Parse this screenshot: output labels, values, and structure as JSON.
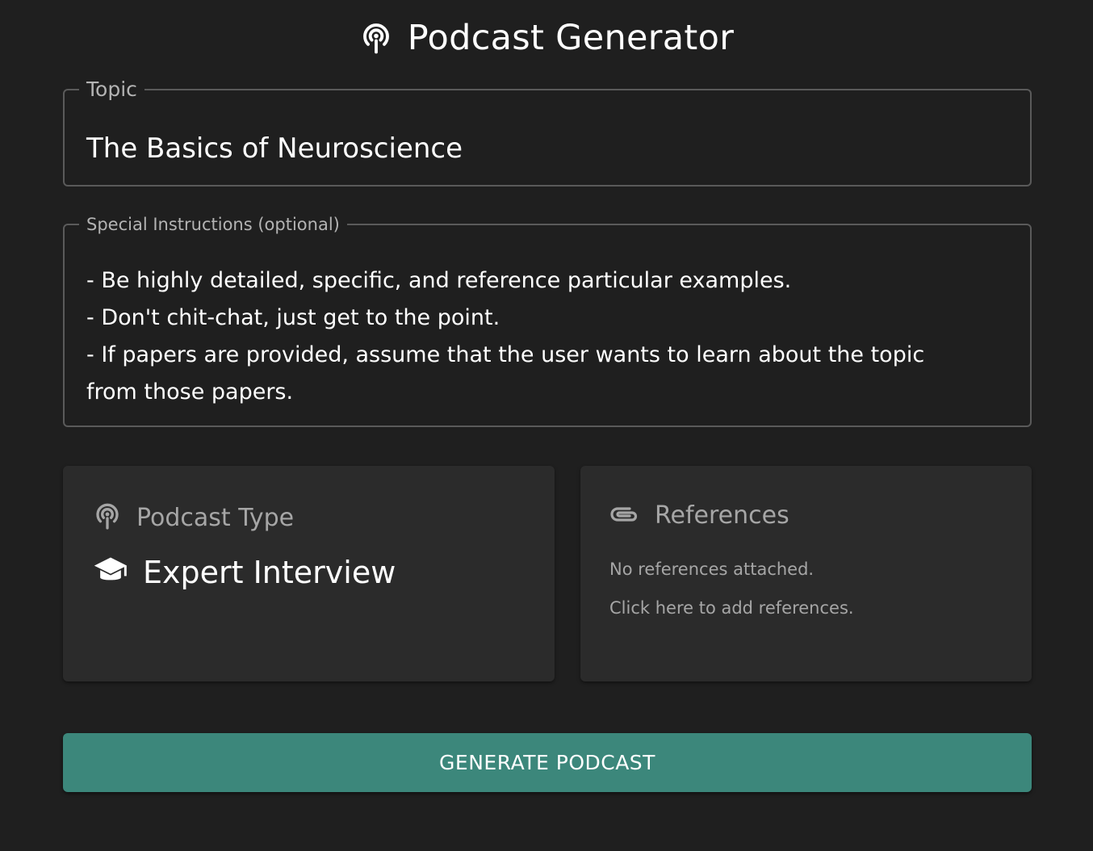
{
  "header": {
    "title": "Podcast Generator",
    "icon": "podcast-icon"
  },
  "topic": {
    "label": "Topic",
    "value": "The Basics of Neuroscience"
  },
  "instructions": {
    "label": "Special Instructions (optional)",
    "lines": [
      "- Be highly detailed, specific, and reference particular examples.",
      "- Don't chit-chat, just get to the point.",
      "- If papers are provided, assume that the user wants to learn about the topic",
      "from those papers."
    ]
  },
  "podcast_type": {
    "title": "Podcast Type",
    "icon": "podcast-icon",
    "value": "Expert Interview",
    "value_icon": "graduation-cap-icon"
  },
  "references": {
    "title": "References",
    "icon": "paperclip-icon",
    "empty_text": "No references attached.",
    "add_text": "Click here to add references."
  },
  "actions": {
    "generate_label": "GENERATE PODCAST"
  },
  "colors": {
    "background": "#1f1f1f",
    "card": "#2b2b2b",
    "accent": "#3c877b"
  }
}
